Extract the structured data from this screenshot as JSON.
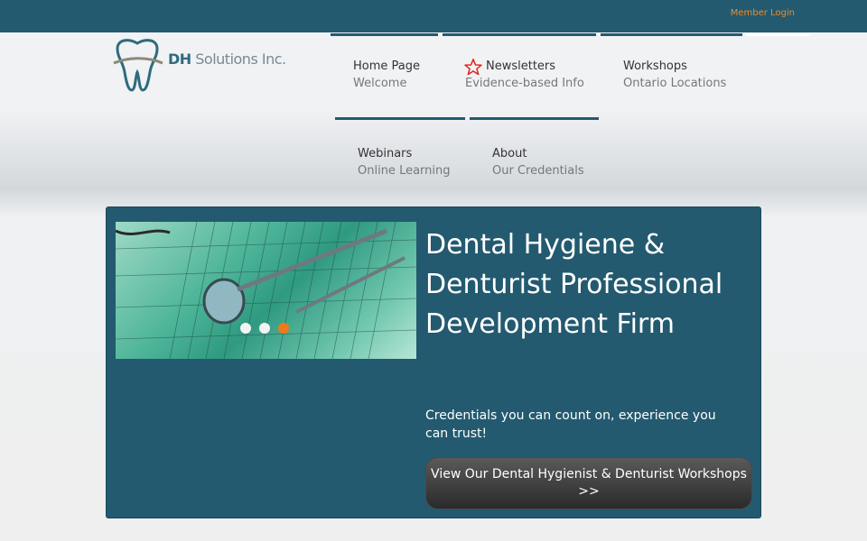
{
  "topbar": {
    "member_login": "Member Login"
  },
  "logo": {
    "brand_bold": "DH",
    "brand_rest": " Solutions Inc."
  },
  "nav": [
    {
      "title": "Home Page",
      "sub": "Welcome"
    },
    {
      "title": "Newsletters",
      "sub": "Evidence-based Info",
      "icon": "star-outline-icon"
    },
    {
      "title": "Workshops",
      "sub": "Ontario Locations"
    },
    {
      "title": "Webinars",
      "sub": "Online Learning"
    },
    {
      "title": "About",
      "sub": "Our Credentials"
    }
  ],
  "hero": {
    "title": "Dental Hygiene & Denturist Professional Development Firm",
    "subtitle": "Credentials you can count on, experience you can trust!",
    "cta": "View Our Dental Hygienist & Denturist Workshops >>",
    "slider": {
      "count": 3,
      "active_index": 2
    }
  },
  "colors": {
    "brand": "#235a6f",
    "accent": "#f08a2a",
    "active_dot": "#f07a1a"
  }
}
